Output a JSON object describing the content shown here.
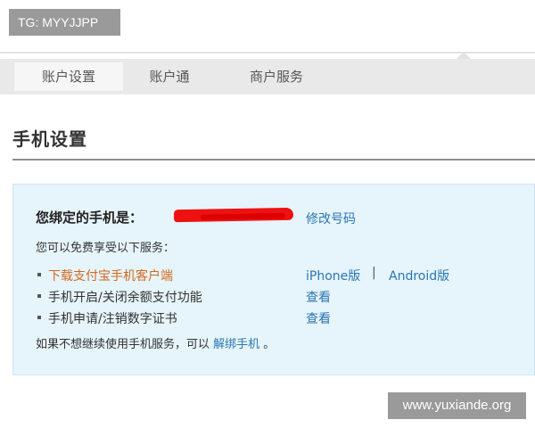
{
  "watermarks": {
    "top_left": "TG: MYYJJPP",
    "bottom_right": "www.yuxiande.org"
  },
  "tabs": [
    {
      "label": "账户设置",
      "active": true
    },
    {
      "label": "账户通",
      "active": false
    },
    {
      "label": "商户服务",
      "active": false
    }
  ],
  "page": {
    "title": "手机设置"
  },
  "phone": {
    "label": "您绑定的手机是：",
    "number_redacted": true,
    "modify_link": "修改号码"
  },
  "services": {
    "intro": "您可以免费享受以下服务：",
    "items": [
      {
        "label": "下载支付宝手机客户端",
        "highlight": true
      },
      {
        "label": "手机开启/关闭余额支付功能",
        "highlight": false
      },
      {
        "label": "手机申请/注销数字证书",
        "highlight": false
      }
    ],
    "actions": {
      "iphone": "iPhone版",
      "separator": "|",
      "android": "Android版",
      "view_1": "查看",
      "view_2": "查看"
    }
  },
  "footer": {
    "text_before": "如果不想继续使用手机服务，可以 ",
    "unbind_link": "解绑手机",
    "text_after": " 。"
  },
  "colors": {
    "link": "#2a76b3",
    "highlight": "#d2691e",
    "panel_bg": "#e6f4fb",
    "redaction": "#ee1111"
  }
}
